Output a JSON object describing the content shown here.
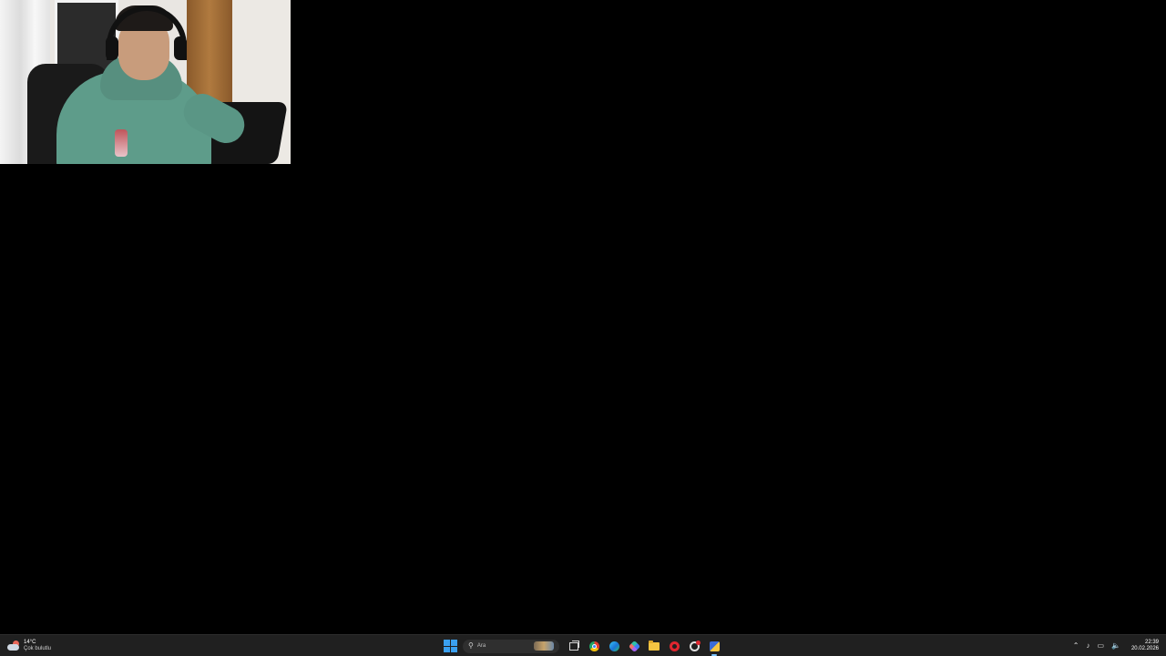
{
  "webcam": {
    "description_hidden": ""
  },
  "taskbar": {
    "weather": {
      "temperature": "14°C",
      "condition": "Çok bulutlu"
    },
    "search": {
      "placeholder": "Ara"
    },
    "apps": [
      {
        "name": "task-view"
      },
      {
        "name": "chrome"
      },
      {
        "name": "edge"
      },
      {
        "name": "copilot"
      },
      {
        "name": "file-explorer"
      },
      {
        "name": "opera"
      },
      {
        "name": "tool"
      },
      {
        "name": "notes"
      }
    ],
    "tray": {
      "time": "22:39",
      "date": "20.02.2026"
    }
  },
  "colors": {
    "desktop": "#000000",
    "taskbar": "#202020",
    "start_accent": "#3aa0f0"
  }
}
